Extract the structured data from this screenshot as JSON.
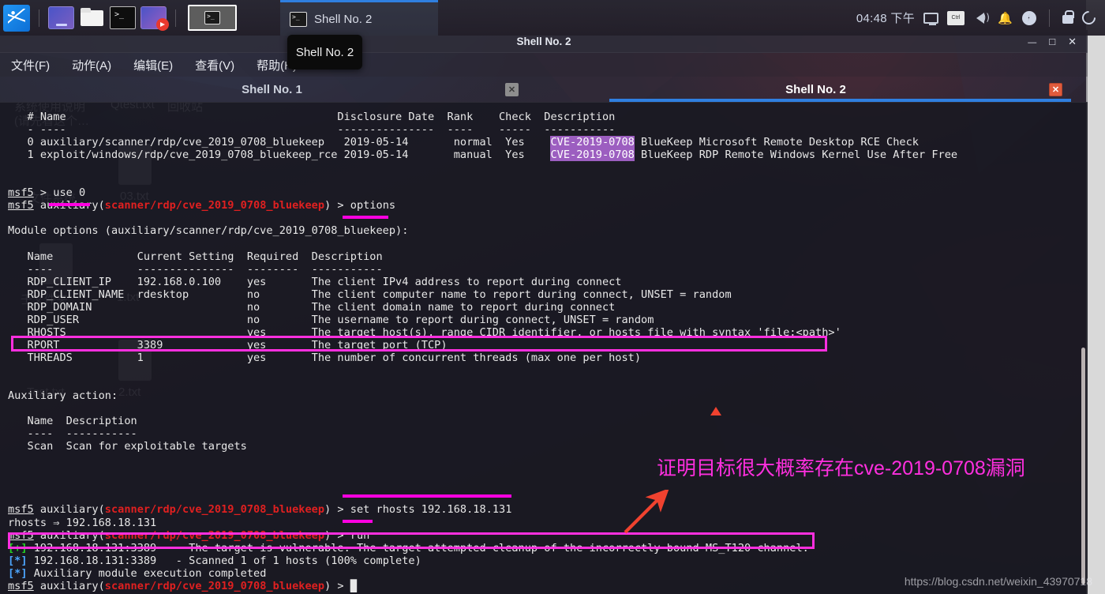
{
  "panel": {
    "apps": [
      {
        "name": "kali-menu-icon",
        "label": "Kali Menu"
      },
      {
        "name": "monitor-icon",
        "label": "Display Settings"
      },
      {
        "name": "folder-icon",
        "label": "File Manager"
      },
      {
        "name": "terminal-icon",
        "label": "Terminal"
      },
      {
        "name": "screen-recorder-icon",
        "label": "Screen Recorder"
      }
    ],
    "active_window_button": "terminal-window-button",
    "taskbar_item_label": "Shell No. 2",
    "clock": "04:48 下午",
    "tray": [
      {
        "name": "display-icon",
        "label": "Display"
      },
      {
        "name": "keyboard-layout-icon",
        "label": "Ctrl"
      },
      {
        "name": "volume-icon",
        "label": "Volume"
      },
      {
        "name": "notification-bell-icon",
        "label": "Notifications"
      },
      {
        "name": "power-icon",
        "label": "Power"
      },
      {
        "name": "lock-icon",
        "label": "Lock Screen"
      },
      {
        "name": "logout-icon",
        "label": "Log Out"
      }
    ]
  },
  "tooltip": {
    "text": "Shell No. 2"
  },
  "window": {
    "title": "Shell No. 2",
    "controls": {
      "minimize": "—",
      "maximize": "□",
      "close": "✕"
    },
    "menu": [
      {
        "label": "文件(F)",
        "name": "menu-file"
      },
      {
        "label": "动作(A)",
        "name": "menu-actions"
      },
      {
        "label": "编辑(E)",
        "name": "menu-edit"
      },
      {
        "label": "查看(V)",
        "name": "menu-view"
      },
      {
        "label": "帮助(H)",
        "name": "menu-help"
      }
    ],
    "tabs": [
      {
        "label": "Shell No. 1",
        "active": false,
        "close": "✕"
      },
      {
        "label": "Shell No. 2",
        "active": true,
        "close": "✕"
      }
    ]
  },
  "terminal": {
    "search_results": {
      "headers": [
        "#",
        "Name",
        "Disclosure Date",
        "Rank",
        "Check",
        "Description"
      ],
      "rules": [
        "-",
        "----",
        "---------------",
        "----",
        "-----",
        "-----------"
      ],
      "rows": [
        {
          "index": "0",
          "name": "auxiliary/scanner/rdp/cve_2019_0708_bluekeep",
          "date": "2019-05-14",
          "rank": "normal",
          "check": "Yes",
          "cve": "CVE-2019-0708",
          "desc": "BlueKeep Microsoft Remote Desktop RCE Check"
        },
        {
          "index": "1",
          "name": "exploit/windows/rdp/cve_2019_0708_bluekeep_rce",
          "date": "2019-05-14",
          "rank": "manual",
          "check": "Yes",
          "cve": "CVE-2019-0708",
          "desc": "BlueKeep RDP Remote Windows Kernel Use After Free"
        }
      ]
    },
    "prompt_plain": "msf5",
    "prompt_module": "scanner/rdp/cve_2019_0708_bluekeep",
    "commands": {
      "use": "use 0",
      "options": "options",
      "set_rhosts": "set rhosts 192.168.18.131",
      "run": "run"
    },
    "module_options_header": "Module options (auxiliary/scanner/rdp/cve_2019_0708_bluekeep):",
    "options_table": {
      "headers": [
        "Name",
        "Current Setting",
        "Required",
        "Description"
      ],
      "rules": [
        "----",
        "---------------",
        "--------",
        "-----------"
      ],
      "rows": [
        {
          "name": "RDP_CLIENT_IP",
          "setting": "192.168.0.100",
          "required": "yes",
          "desc": "The client IPv4 address to report during connect"
        },
        {
          "name": "RDP_CLIENT_NAME",
          "setting": "rdesktop",
          "required": "no",
          "desc": "The client computer name to report during connect, UNSET = random"
        },
        {
          "name": "RDP_DOMAIN",
          "setting": "",
          "required": "no",
          "desc": "The client domain name to report during connect"
        },
        {
          "name": "RDP_USER",
          "setting": "",
          "required": "no",
          "desc": "The username to report during connect, UNSET = random"
        },
        {
          "name": "RHOSTS",
          "setting": "",
          "required": "yes",
          "desc": "The target host(s), range CIDR identifier, or hosts file with syntax 'file:<path>'"
        },
        {
          "name": "RPORT",
          "setting": "3389",
          "required": "yes",
          "desc": "The target port (TCP)"
        },
        {
          "name": "THREADS",
          "setting": "1",
          "required": "yes",
          "desc": "The number of concurrent threads (max one per host)"
        }
      ]
    },
    "auxiliary_action": {
      "title": "Auxiliary action:",
      "headers": [
        "Name",
        "Description"
      ],
      "rules": [
        "----",
        "-----------"
      ],
      "rows": [
        {
          "name": "Scan",
          "desc": "Scan for exploitable targets"
        }
      ]
    },
    "set_result": "rhosts ⇒ 192.168.18.131",
    "run_output": [
      {
        "marker": "[+]",
        "level": "plus",
        "text": "192.168.18.131:3389   - The target is vulnerable. The target attempted cleanup of the incorrectly-bound MS_T120 channel."
      },
      {
        "marker": "[*]",
        "level": "star",
        "text": "192.168.18.131:3389   - Scanned 1 of 1 hosts (100% complete)"
      },
      {
        "marker": "[*]",
        "level": "star",
        "text": "Auxiliary module execution completed"
      }
    ]
  },
  "annotation": {
    "note_text": "证明目标很大概率存在cve-2019-0708漏洞",
    "note_color": "#ff2fdf",
    "arrow_color": "#f0422f",
    "highlight_color": "#ff2fdf"
  },
  "watermark": {
    "text": "https://blog.csdn.net/weixin_43970718"
  }
}
